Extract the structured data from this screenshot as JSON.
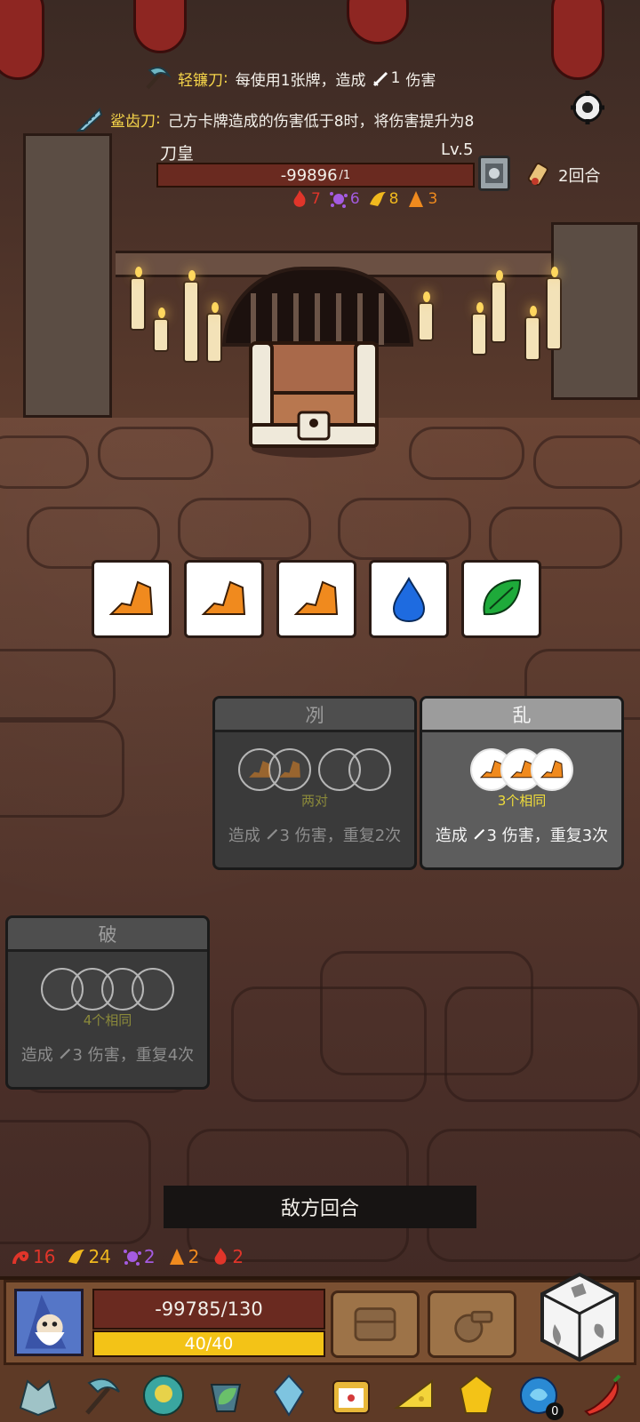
{
  "relics_header": [
    {
      "name": "轻镰刀",
      "colon": ":",
      "desc_before": "每使用1张牌，造成",
      "value": "1",
      "desc_after": "伤害"
    },
    {
      "name": "鲨齿刀",
      "colon": ":",
      "desc": "己方卡牌造成的伤害低于8时，将伤害提升为8"
    }
  ],
  "enemy": {
    "name": "刀皇",
    "level": "Lv.5",
    "hp": "-99896",
    "hp_max": "/1",
    "round": "2回合",
    "stats": [
      {
        "icon": "red-flame-icon",
        "value": "7",
        "color": "#e0352a"
      },
      {
        "icon": "purple-splat-icon",
        "value": "6",
        "color": "#a45be0"
      },
      {
        "icon": "yellow-fire-icon",
        "value": "8",
        "color": "#f0b81e"
      },
      {
        "icon": "orange-fire-icon",
        "value": "3",
        "color": "#f08a1e"
      }
    ]
  },
  "dice": [
    {
      "type": "orange-rock"
    },
    {
      "type": "orange-rock"
    },
    {
      "type": "orange-rock"
    },
    {
      "type": "blue-drop"
    },
    {
      "type": "green-leaf"
    }
  ],
  "skills": [
    {
      "title": "冽",
      "condition": "两对",
      "effect_before": "造成",
      "damage": "3",
      "effect_after": "伤害，重复2次",
      "active": false
    },
    {
      "title": "乱",
      "condition": "3个相同",
      "effect_before": "造成",
      "damage": "3",
      "effect_after": "伤害，重复3次",
      "active": true
    },
    {
      "title": "破",
      "condition": "4个相同",
      "effect_before": "造成",
      "damage": "3",
      "effect_after": "伤害，重复4次",
      "active": false
    }
  ],
  "turn_banner": "敌方回合",
  "player": {
    "stats": [
      {
        "icon": "red-swirl-icon",
        "value": "16",
        "color": "#e0352a"
      },
      {
        "icon": "yellow-fire-icon",
        "value": "24",
        "color": "#f0b81e"
      },
      {
        "icon": "purple-splat-icon",
        "value": "2",
        "color": "#a45be0"
      },
      {
        "icon": "orange-fire-icon",
        "value": "2",
        "color": "#f08a1e"
      },
      {
        "icon": "red-flame-icon",
        "value": "2",
        "color": "#e0352a"
      }
    ],
    "hp": "-99785/130",
    "energy": "40/40",
    "energy_fraction": 1.0
  },
  "relic_bar": [
    {
      "icon": "dragon-skull-icon"
    },
    {
      "icon": "sickle-icon"
    },
    {
      "icon": "jade-mask-icon"
    },
    {
      "icon": "leaf-cup-icon"
    },
    {
      "icon": "ice-crystal-icon"
    },
    {
      "icon": "dice-box-icon"
    },
    {
      "icon": "cheese-icon"
    },
    {
      "icon": "gold-gem-icon"
    },
    {
      "icon": "blue-orb-icon",
      "badge": "0"
    },
    {
      "icon": "red-chili-icon"
    }
  ]
}
